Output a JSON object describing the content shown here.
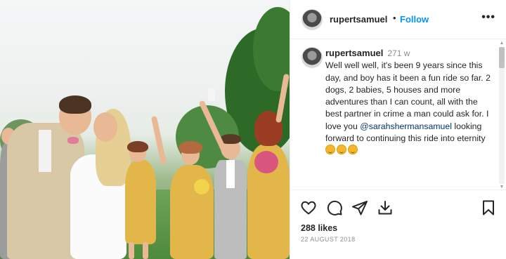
{
  "post": {
    "username": "rupertsamuel",
    "separator": "•",
    "follow_label": "Follow",
    "more_label": "•••"
  },
  "caption": {
    "username": "rupertsamuel",
    "time": "271 w",
    "text_before_mention": "Well well well, it's been 9 years since this day, and boy has it been a fun ride so far. 2 dogs, 2 babies, 5 houses and more adventures than I can count, all with the best partner in crime a man could ask for. I love you",
    "mention": "@sarahshermansamuel",
    "text_after_mention": "looking forward to continuing this ride into eternity",
    "emojis": [
      "smiling-face-emoji",
      "smiling-face-emoji",
      "smiling-face-emoji"
    ]
  },
  "actions": {
    "icons": [
      "heart-icon",
      "comment-icon",
      "share-icon",
      "download-icon",
      "bookmark-icon"
    ]
  },
  "likes": "288 likes",
  "date": "22 AUGUST 2018",
  "colors": {
    "accent": "#0095f6",
    "mention": "#00376b",
    "muted": "#8e8e8e",
    "text": "#262626"
  }
}
